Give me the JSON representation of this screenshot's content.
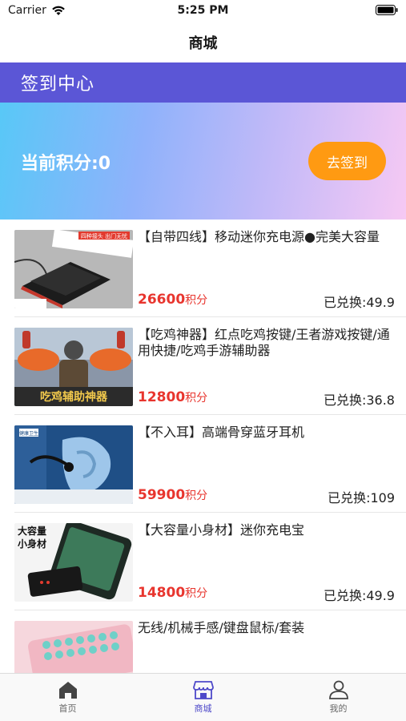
{
  "status_bar": {
    "carrier": "Carrier",
    "time": "5:25 PM"
  },
  "nav": {
    "title": "商城"
  },
  "signin": {
    "title": "签到中心",
    "points_text": "当前积分:0",
    "checkin_label": "去签到"
  },
  "products": [
    {
      "title": "【自带四线】移动迷你充电源●完美大容量",
      "points": "26600",
      "unit": "积分",
      "redeemed": "已兑换:49.9"
    },
    {
      "title": "【吃鸡神器】红点吃鸡按键/王者游戏按键/通用快捷/吃鸡手游辅助器",
      "points": "12800",
      "unit": "积分",
      "redeemed": "已兑换:36.8"
    },
    {
      "title": "【不入耳】高端骨穿蓝牙耳机",
      "points": "59900",
      "unit": "积分",
      "redeemed": "已兑换:109"
    },
    {
      "title": "【大容量小身材】迷你充电宝",
      "points": "14800",
      "unit": "积分",
      "redeemed": "已兑换:49.9"
    },
    {
      "title": "无线/机械手感/键盘鼠标/套装",
      "points": "",
      "unit": "",
      "redeemed": ""
    }
  ],
  "image_text": {
    "p1_banner": "四种接头 出门无忧",
    "p2_banner": "吃鸡辅助神器",
    "p3_tag": "健康卫生",
    "p4_line1": "大容量",
    "p4_line2": "小身材"
  },
  "tabs": [
    {
      "label": "首页",
      "icon": "home-icon",
      "active": false
    },
    {
      "label": "商城",
      "icon": "store-icon",
      "active": true
    },
    {
      "label": "我的",
      "icon": "user-icon",
      "active": false
    }
  ],
  "colors": {
    "accent": "#5b56d6",
    "button": "#ff9a12",
    "price": "#e8352e",
    "tab_active": "#4e49c9"
  }
}
